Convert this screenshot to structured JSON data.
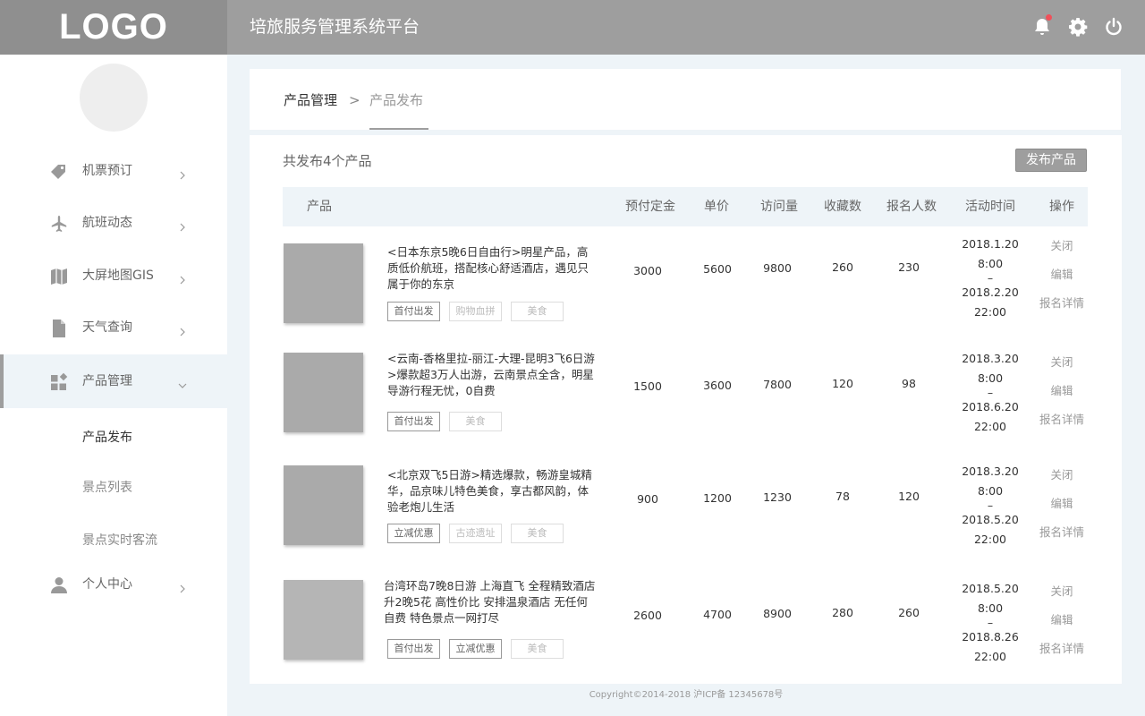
{
  "header": {
    "logo": "LOGO",
    "title": "培旅服务管理系统平台",
    "icons": [
      "bell-icon",
      "gear-icon",
      "power-icon"
    ],
    "notification_dot_color": "#f0505a"
  },
  "sidebar": {
    "items": [
      {
        "label": "机票预订",
        "icon": "tag-icon"
      },
      {
        "label": "航班动态",
        "icon": "airplane-icon"
      },
      {
        "label": "大屏地图GIS",
        "icon": "map-icon"
      },
      {
        "label": "天气查询",
        "icon": "document-icon"
      },
      {
        "label": "产品管理",
        "icon": "grid-icon",
        "expanded": true
      },
      {
        "label": "个人中心",
        "icon": "person-icon"
      }
    ],
    "sub_items": [
      {
        "label": "产品发布",
        "current": true
      },
      {
        "label": "景点列表"
      },
      {
        "label": "景点实时客流"
      }
    ]
  },
  "breadcrumb": {
    "root": "产品管理",
    "separator": ">",
    "current": "产品发布"
  },
  "main": {
    "summary": "共发布4个产品",
    "publish_button": "发布产品",
    "columns": [
      "产品",
      "预付定金",
      "单价",
      "访问量",
      "收藏数",
      "报名人数",
      "活动时间",
      "操作"
    ],
    "products": [
      {
        "description": "<日本东京5晚6日自由行>明星产品，高质低价航班，搭配核心舒适酒店，遇见只属于你的东京",
        "tags": [
          {
            "label": "首付出发",
            "active": true
          },
          {
            "label": "购物血拼",
            "active": false
          },
          {
            "label": "美食",
            "active": false
          }
        ],
        "deposit": "3000",
        "price": "5600",
        "visits": "9800",
        "favorites": "260",
        "signups": "230",
        "time": {
          "start_date": "2018.1.20",
          "start_time": "8:00",
          "dash": "–",
          "end_date": "2018.2.20",
          "end_time": "22:00"
        },
        "ops": [
          "关闭",
          "编辑",
          "报名详情"
        ]
      },
      {
        "description": "<云南-香格里拉-丽江-大理-昆明3飞6日游>爆款超3万人出游，云南景点全含，明星导游行程无忧，0自费",
        "tags": [
          {
            "label": "首付出发",
            "active": true
          },
          {
            "label": "美食",
            "active": false
          }
        ],
        "deposit": "1500",
        "price": "3600",
        "visits": "7800",
        "favorites": "120",
        "signups": "98",
        "time": {
          "start_date": "2018.3.20",
          "start_time": "8:00",
          "dash": "–",
          "end_date": "2018.6.20",
          "end_time": "22:00"
        },
        "ops": [
          "关闭",
          "编辑",
          "报名详情"
        ]
      },
      {
        "description": "<北京双飞5日游>精选爆款，畅游皇城精华，品京味儿特色美食，享古都风韵，体验老炮儿生活",
        "tags": [
          {
            "label": "立减优惠",
            "active": true
          },
          {
            "label": "古迹遗址",
            "active": false
          },
          {
            "label": "美食",
            "active": false
          }
        ],
        "deposit": "900",
        "price": "1200",
        "visits": "1230",
        "favorites": "78",
        "signups": "120",
        "time": {
          "start_date": "2018.3.20",
          "start_time": "8:00",
          "dash": "–",
          "end_date": "2018.5.20",
          "end_time": "22:00"
        },
        "ops": [
          "关闭",
          "编辑",
          "报名详情"
        ]
      },
      {
        "description": "台湾环岛7晚8日游 上海直飞 全程精致酒店升2晚5花 高性价比 安排温泉酒店 无任何自费 特色景点一网打尽",
        "tags": [
          {
            "label": "首付出发",
            "active": true
          },
          {
            "label": "立减优惠",
            "active": true
          },
          {
            "label": "美食",
            "active": false
          }
        ],
        "deposit": "2600",
        "price": "4700",
        "visits": "8900",
        "favorites": "280",
        "signups": "260",
        "time": {
          "start_date": "2018.5.20",
          "start_time": "8:00",
          "dash": "–",
          "end_date": "2018.8.26",
          "end_time": "22:00"
        },
        "ops": [
          "关闭",
          "编辑",
          "报名详情"
        ]
      }
    ]
  },
  "footer": "Copyright©2014-2018 沪ICP备 12345678号"
}
